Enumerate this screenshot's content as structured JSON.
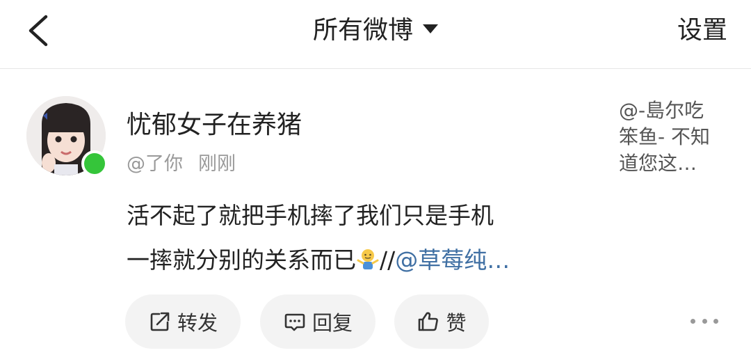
{
  "header": {
    "back_icon": "chevron-left-icon",
    "title": "所有微博",
    "title_caret_icon": "caret-down-icon",
    "settings_label": "设置"
  },
  "post": {
    "avatar": "avatar",
    "online_status_color": "#35c53a",
    "username": "忧郁女子在养猪",
    "reply_to": "@了你",
    "time": "刚刚",
    "side_note": [
      "@-島尔吃",
      "笨鱼- 不知",
      "道您这…"
    ],
    "content_line1": "活不起了就把手机摔了我们只是手机",
    "content_line2": "一摔就分别的关系而已",
    "content_separator": "//",
    "content_mention": "@草莓纯…",
    "mention_color": "#3f6fa3"
  },
  "actions": {
    "repost_label": "转发",
    "reply_label": "回复",
    "like_label": "赞",
    "more_icon": "more-dots-icon"
  }
}
